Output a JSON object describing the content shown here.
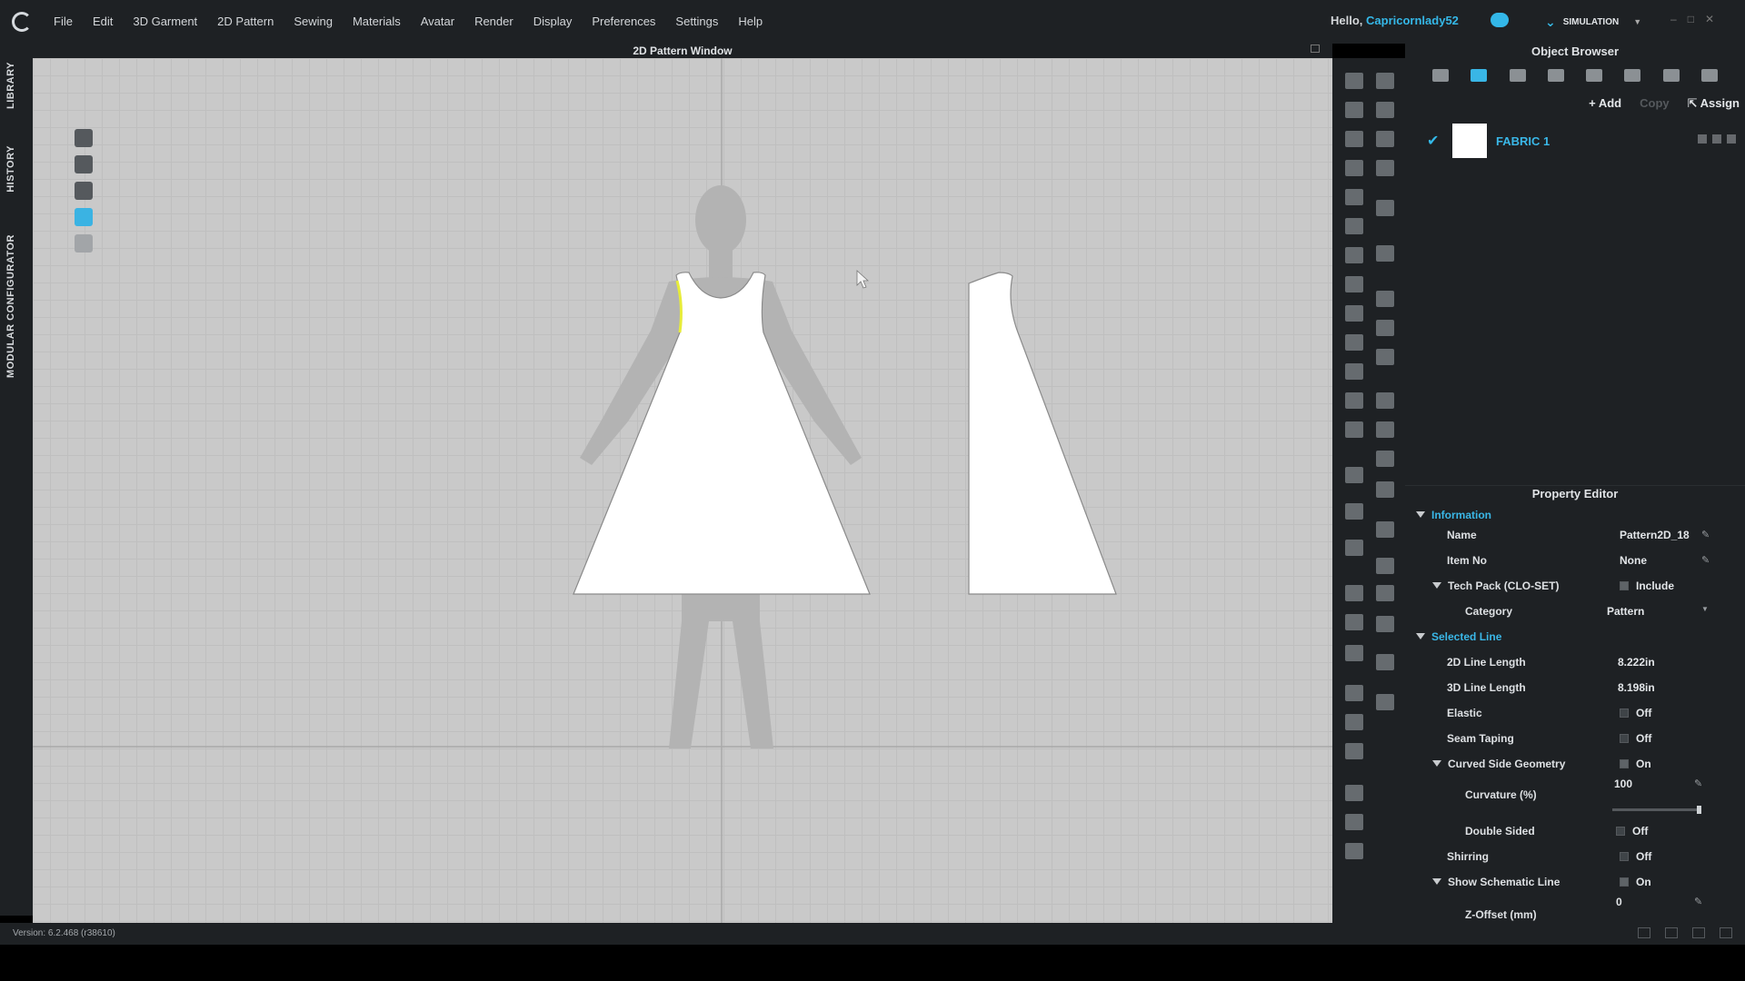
{
  "menubar": {
    "items": [
      "File",
      "Edit",
      "3D Garment",
      "2D Pattern",
      "Sewing",
      "Materials",
      "Avatar",
      "Render",
      "Display",
      "Preferences",
      "Settings",
      "Help"
    ],
    "greeting": "Hello,",
    "username": "Capricornlady52",
    "mode": "SIMULATION"
  },
  "left_tabs": [
    "LIBRARY",
    "HISTORY",
    "MODULAR CONFIGURATOR"
  ],
  "pattern_window": {
    "title": "2D Pattern Window"
  },
  "object_browser": {
    "title": "Object Browser",
    "actions": {
      "add": "Add",
      "copy": "Copy",
      "assign": "Assign"
    },
    "fabric": {
      "name": "FABRIC 1"
    }
  },
  "property_editor": {
    "title": "Property Editor",
    "information": {
      "header": "Information",
      "name_label": "Name",
      "name_value": "Pattern2D_18",
      "item_label": "Item No",
      "item_value": "None",
      "techpack_label": "Tech Pack (CLO-SET)",
      "techpack_value": "Include",
      "category_label": "Category",
      "category_value": "Pattern"
    },
    "selected_line": {
      "header": "Selected Line",
      "len2d_label": "2D Line Length",
      "len2d_value": "8.222in",
      "len3d_label": "3D Line Length",
      "len3d_value": "8.198in",
      "elastic_label": "Elastic",
      "elastic_value": "Off",
      "seam_label": "Seam Taping",
      "seam_value": "Off",
      "curved_label": "Curved Side Geometry",
      "curved_value": "On",
      "curvature_label": "Curvature (%)",
      "curvature_value": "100",
      "double_label": "Double Sided",
      "double_value": "Off",
      "shirring_label": "Shirring",
      "shirring_value": "Off",
      "schematic_label": "Show Schematic Line",
      "schematic_value": "On",
      "zoffset_label": "Z-Offset (mm)",
      "zoffset_value": "0"
    }
  },
  "statusbar": {
    "version": "Version: 6.2.468 (r38610)"
  }
}
